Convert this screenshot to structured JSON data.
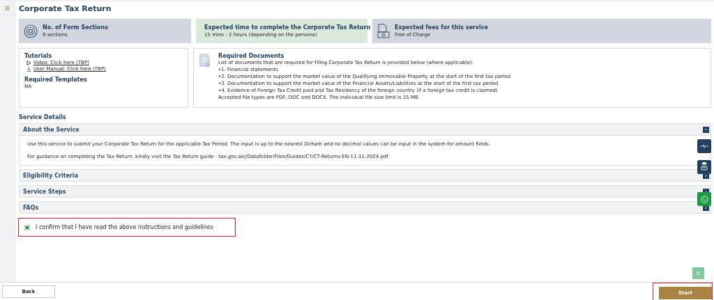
{
  "page_title": "Corporate Tax Return",
  "info_cards": [
    {
      "kind": "sections",
      "title": "No. of Form Sections",
      "value": "9 sections"
    },
    {
      "kind": "time",
      "title": "Expected time to complete the Corporate Tax Return",
      "value": "15 mins - 2 hours (depending on the persona)"
    },
    {
      "kind": "fees",
      "title": "Expected fees for this service",
      "value": "Free of Charge"
    }
  ],
  "tutorials": {
    "title": "Tutorials",
    "links": [
      {
        "kind": "video",
        "label": "Video: Click here (TBP)"
      },
      {
        "kind": "download",
        "label": "User Manual: Click here (TBP)"
      }
    ],
    "templates_title": "Required Templates",
    "templates_value": "NA"
  },
  "required_documents": {
    "title": "Required Documents",
    "lines": [
      "List of documents that are required for Filing Corporate Tax Return is provided below (where applicable):",
      "•1. Financial statements",
      "•2. Documentation to support the market value of the Qualifying Immovable Property at the start of the first tax period",
      "•3. Documentation to support the market value of the Financial Assets/Liabilities at the start of the first tax period",
      "•4. Evidence of Foreign Tax Credit paid and Tax Residency of the foreign country (if a foreign tax credit is claimed)",
      "Accepted file types are PDF, DOC and DOCX. The individual file size limit is 15 MB."
    ]
  },
  "service_details_title": "Service Details",
  "sections": [
    {
      "title": "About the Service",
      "expanded": true,
      "paragraphs": [
        "Use this service to submit your Corporate Tax Return for the applicable Tax Period. The input is up to the nearest Dirham and no decimal values can be input in the system for amount fields.",
        "For guidance on completing the Tax Return, kindly visit the Tax Return guide - tax.gov.ae//Datafolder/Files/Guides/CT/CT-Returns-EN-11-11-2024.pdf"
      ]
    },
    {
      "title": "Eligibility Criteria",
      "expanded": false
    },
    {
      "title": "Service Steps",
      "expanded": false
    },
    {
      "title": "FAQs",
      "expanded": false
    }
  ],
  "confirmation": {
    "label": "I confirm that I have read the above instructions and guidelines",
    "checked": true,
    "highlighted": true
  },
  "footer": {
    "back": {
      "label": "Back",
      "highlighted": false
    },
    "start": {
      "label": "Start",
      "highlighted": true
    }
  }
}
